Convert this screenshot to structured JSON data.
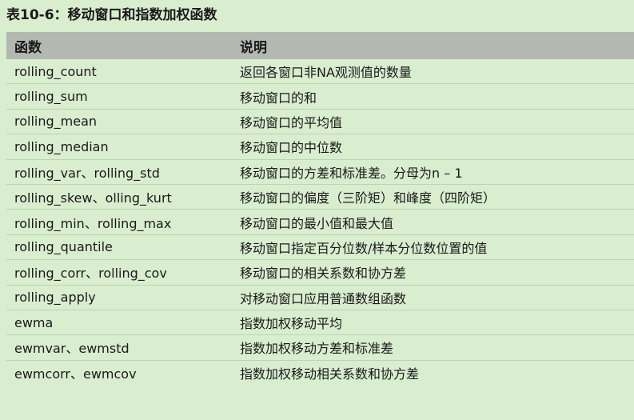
{
  "caption": "表10-6：移动窗口和指数加权函数",
  "table": {
    "headers": [
      "函数",
      "说明"
    ],
    "rows": [
      [
        "rolling_count",
        "返回各窗口非NA观测值的数量"
      ],
      [
        "rolling_sum",
        "移动窗口的和"
      ],
      [
        "rolling_mean",
        "移动窗口的平均值"
      ],
      [
        "rolling_median",
        "移动窗口的中位数"
      ],
      [
        "rolling_var、rolling_std",
        "移动窗口的方差和标准差。分母为n – 1"
      ],
      [
        "rolling_skew、olling_kurt",
        "移动窗口的偏度（三阶矩）和峰度（四阶矩）"
      ],
      [
        "rolling_min、rolling_max",
        "移动窗口的最小值和最大值"
      ],
      [
        "rolling_quantile",
        "移动窗口指定百分位数/样本分位数位置的值"
      ],
      [
        "rolling_corr、rolling_cov",
        "移动窗口的相关系数和协方差"
      ],
      [
        "rolling_apply",
        "对移动窗口应用普通数组函数"
      ],
      [
        "ewma",
        "指数加权移动平均"
      ],
      [
        "ewmvar、ewmstd",
        "指数加权移动方差和标准差"
      ],
      [
        "ewmcorr、ewmcov",
        "指数加权移动相关系数和协方差"
      ]
    ]
  }
}
